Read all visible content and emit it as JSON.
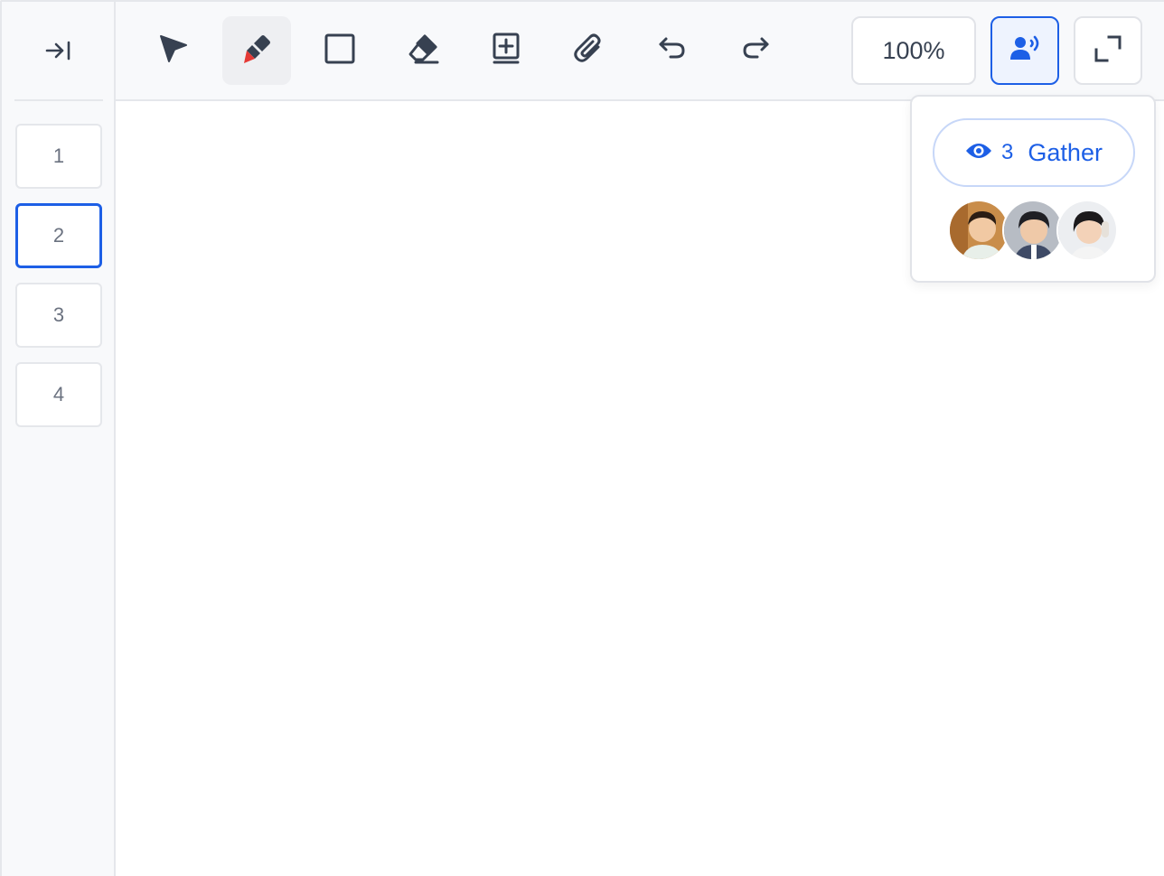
{
  "sidebar": {
    "collapse_icon": "collapse-right-icon",
    "pages": [
      {
        "label": "1"
      },
      {
        "label": "2",
        "active": true
      },
      {
        "label": "3"
      },
      {
        "label": "4"
      }
    ]
  },
  "toolbar": {
    "tools": [
      {
        "name": "select",
        "icon": "cursor-arrow-icon"
      },
      {
        "name": "pen",
        "icon": "marker-pen-icon",
        "active": true
      },
      {
        "name": "rectangle",
        "icon": "square-icon"
      },
      {
        "name": "eraser",
        "icon": "eraser-icon"
      },
      {
        "name": "add-page",
        "icon": "add-page-icon"
      },
      {
        "name": "attachment",
        "icon": "paperclip-icon"
      },
      {
        "name": "undo",
        "icon": "undo-icon"
      },
      {
        "name": "redo",
        "icon": "redo-icon"
      }
    ],
    "zoom_label": "100%",
    "broadcast_icon": "user-broadcast-icon",
    "fullscreen_icon": "fullscreen-icon"
  },
  "popover": {
    "gather": {
      "icon": "eye-icon",
      "count": "3",
      "label": "Gather"
    },
    "avatars": [
      {
        "name": "student-1"
      },
      {
        "name": "student-2"
      },
      {
        "name": "student-3"
      }
    ]
  },
  "colors": {
    "accent": "#1d5fe6",
    "icon": "#374151",
    "pen_tip": "#e53935",
    "sidebar_bg": "#f8f9fb",
    "border": "#e5e7eb"
  }
}
